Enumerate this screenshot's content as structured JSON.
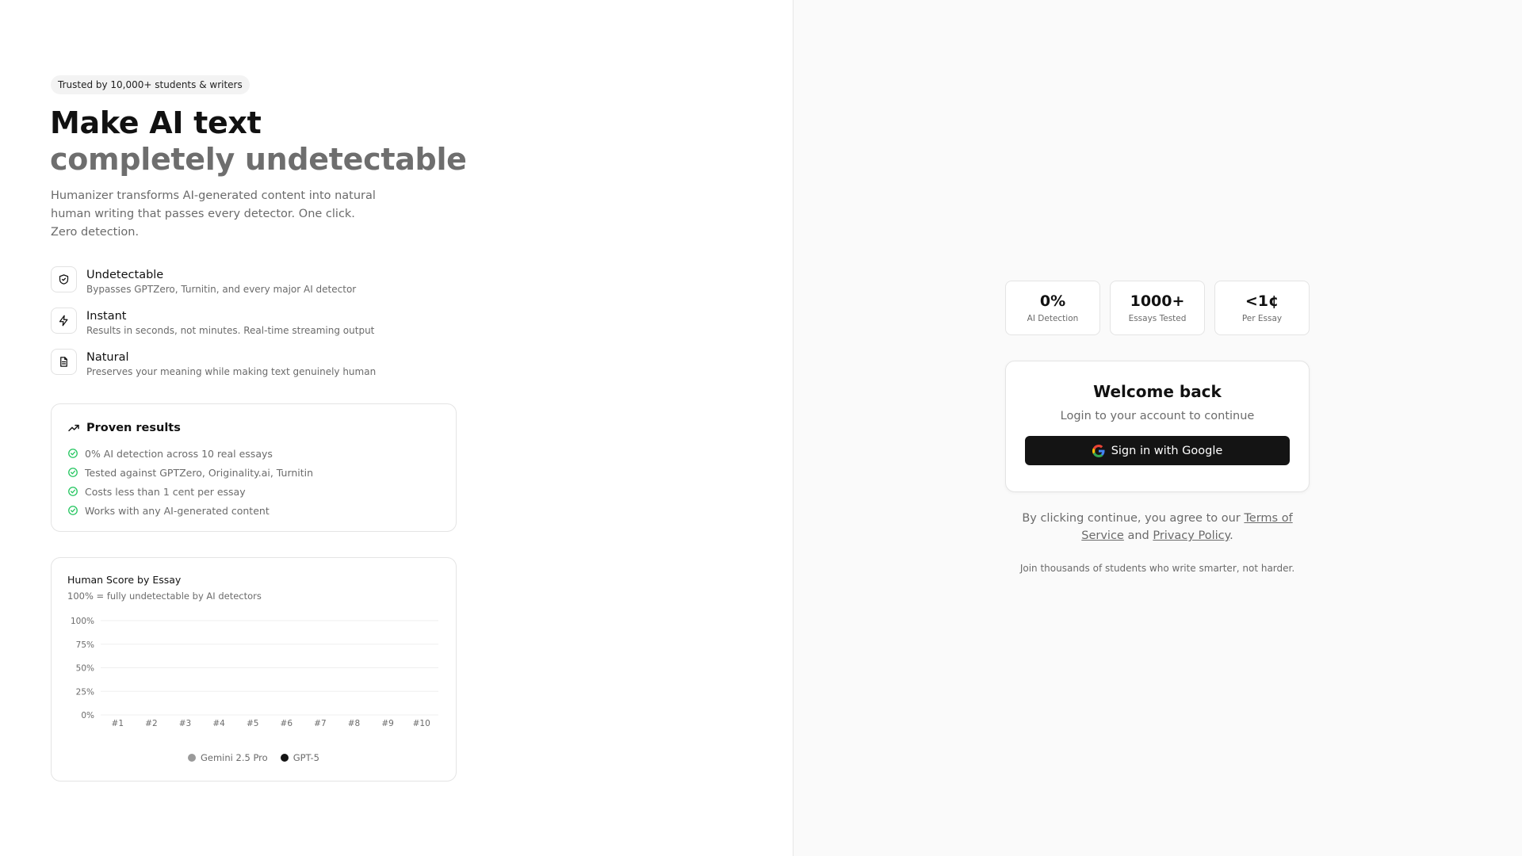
{
  "hero": {
    "badge": "Trusted by 10,000+ students & writers",
    "title_line1": "Make AI text",
    "title_line2": "completely undetectable",
    "description": "Humanizer transforms AI-generated content into natural human writing that passes every detector. One click. Zero detection."
  },
  "features": [
    {
      "icon": "shield-check-icon",
      "title": "Undetectable",
      "desc": "Bypasses GPTZero, Turnitin, and every major AI detector"
    },
    {
      "icon": "lightning-icon",
      "title": "Instant",
      "desc": "Results in seconds, not minutes. Real-time streaming output"
    },
    {
      "icon": "document-icon",
      "title": "Natural",
      "desc": "Preserves your meaning while making text genuinely human"
    }
  ],
  "proven": {
    "title": "Proven results",
    "items": [
      "0% AI detection across 10 real essays",
      "Tested against GPTZero, Originality.ai, Turnitin",
      "Costs less than 1 cent per essay",
      "Works with any AI-generated content"
    ]
  },
  "chart_data": {
    "type": "bar",
    "title": "Human Score by Essay",
    "subtitle": "100% = fully undetectable by AI detectors",
    "categories": [
      "#1",
      "#2",
      "#3",
      "#4",
      "#5",
      "#6",
      "#7",
      "#8",
      "#9",
      "#10"
    ],
    "y_ticks": [
      "100%",
      "75%",
      "50%",
      "25%",
      "0%"
    ],
    "ylim": [
      0,
      100
    ],
    "grid": true,
    "legend_position": "bottom",
    "series": [
      {
        "name": "Gemini 2.5 Pro",
        "color": "#9a9a9a",
        "values": []
      },
      {
        "name": "GPT-5",
        "color": "#141414",
        "values": []
      }
    ]
  },
  "stats": [
    {
      "value": "0%",
      "label": "AI Detection"
    },
    {
      "value": "1000+",
      "label": "Essays Tested"
    },
    {
      "value": "<1¢",
      "label": "Per Essay"
    }
  ],
  "login": {
    "title": "Welcome back",
    "subtitle": "Login to your account to continue",
    "google_button": "Sign in with Google"
  },
  "terms": {
    "prefix": "By clicking continue, you agree to our ",
    "tos_link": "Terms of Service",
    "middle": " and ",
    "privacy_link": "Privacy Policy",
    "suffix": "."
  },
  "join_text": "Join thousands of students who write smarter, not harder.",
  "colors": {
    "accent_green": "#22c55e",
    "button_dark": "#141414",
    "muted_text": "#6b6b6b"
  }
}
